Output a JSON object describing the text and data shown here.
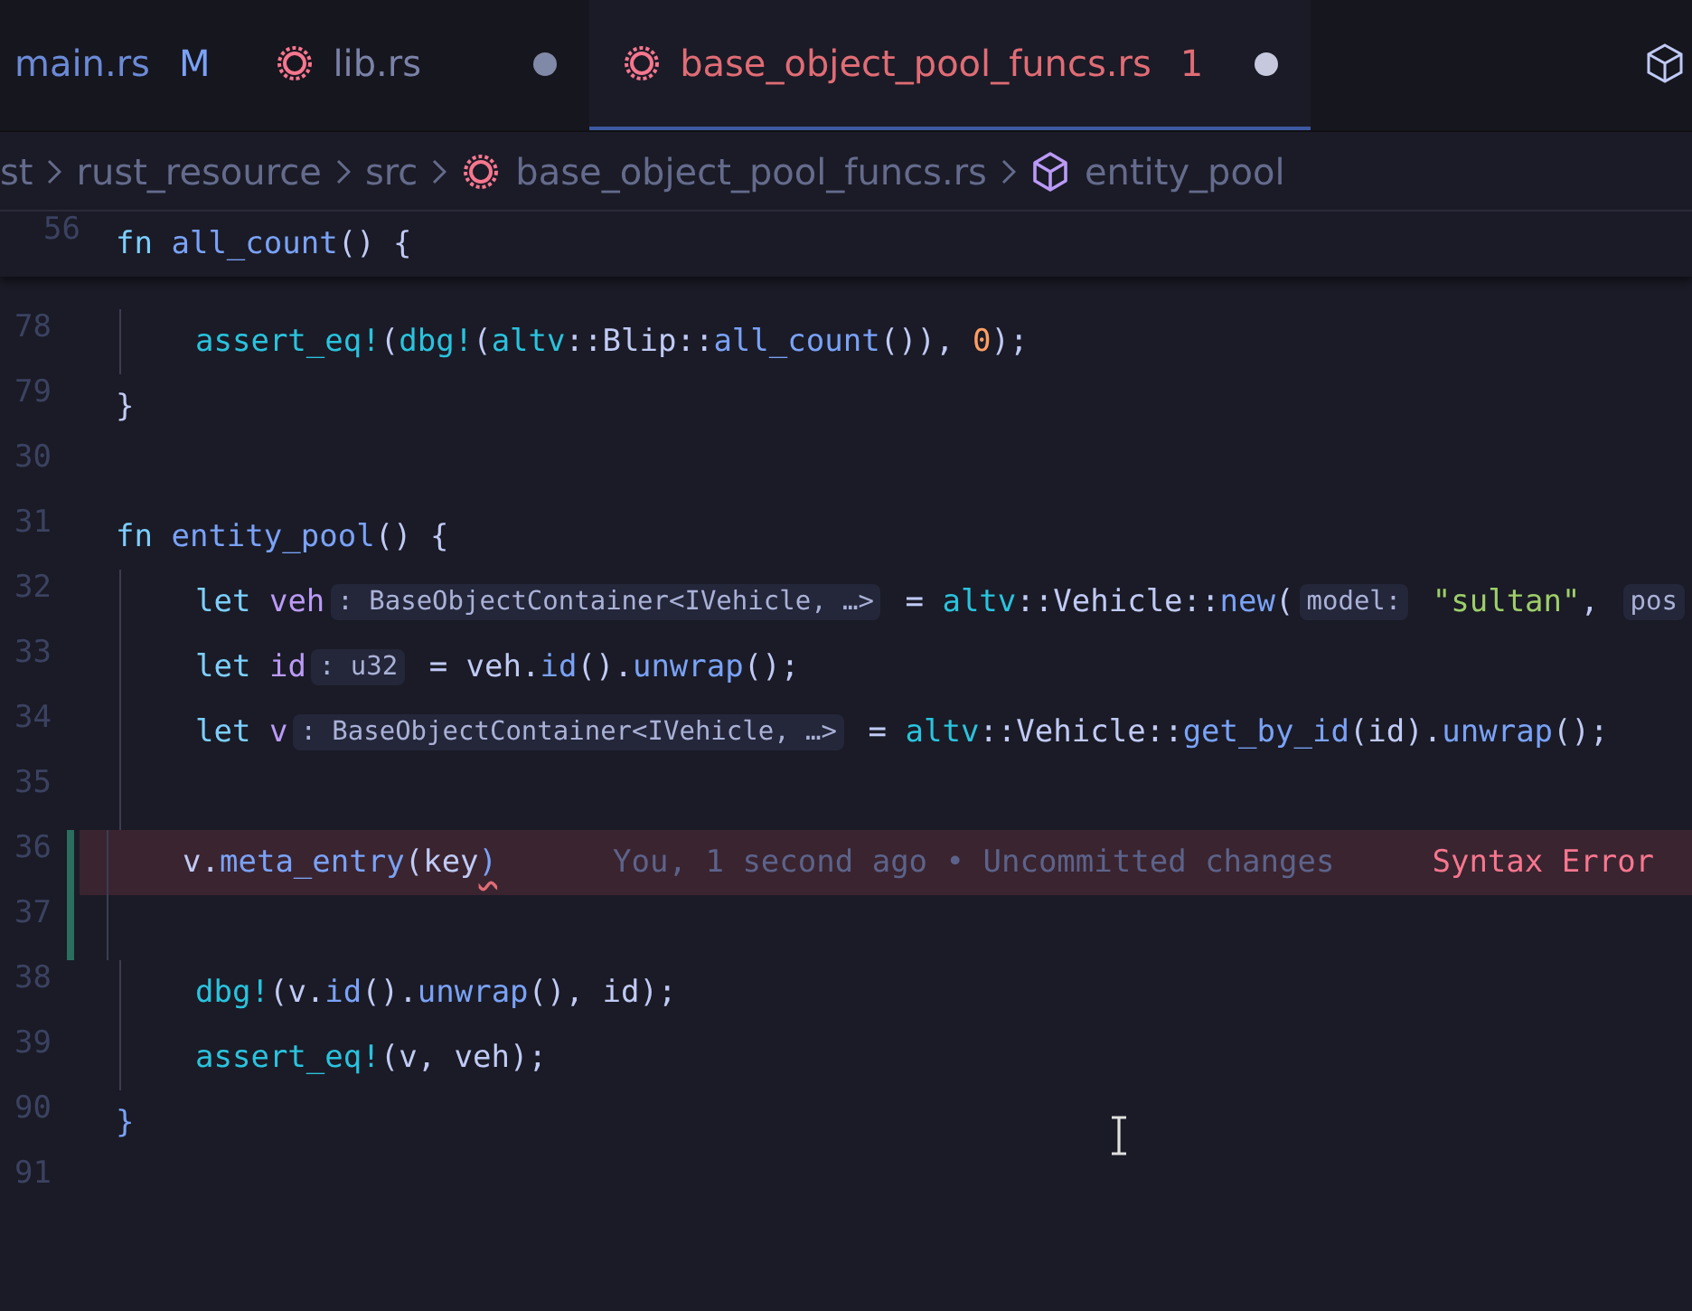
{
  "tabs": [
    {
      "label": "main.rs",
      "kind": "plain",
      "status": "M",
      "dirty": false,
      "error": false,
      "selected": false
    },
    {
      "label": "lib.rs",
      "kind": "rust",
      "dirty": true,
      "error": false,
      "selected": false
    },
    {
      "label": "base_object_pool_funcs.rs",
      "kind": "rust",
      "status": "1",
      "dirty": true,
      "error": true,
      "selected": true
    }
  ],
  "breadcrumb": [
    {
      "label": "st",
      "kind": "folder"
    },
    {
      "label": "rust_resource",
      "kind": "folder"
    },
    {
      "label": "src",
      "kind": "folder"
    },
    {
      "label": "base_object_pool_funcs.rs",
      "kind": "rust"
    },
    {
      "label": "entity_pool",
      "kind": "struct"
    }
  ],
  "sticky_line": {
    "number": "56",
    "tokens": [
      {
        "kind": "keyword",
        "text": "fn "
      },
      {
        "kind": "function",
        "text": "all_count"
      },
      {
        "kind": "punct",
        "text": "() {"
      }
    ]
  },
  "lines": [
    {
      "number": "78",
      "indented": true,
      "modified": false,
      "error": false,
      "tokens": [
        {
          "kind": "macro",
          "text": "assert_eq!"
        },
        {
          "kind": "punct",
          "text": "("
        },
        {
          "kind": "macro",
          "text": "dbg!"
        },
        {
          "kind": "punct",
          "text": "("
        },
        {
          "kind": "namespace",
          "text": "altv"
        },
        {
          "kind": "punct",
          "text": "::"
        },
        {
          "kind": "type",
          "text": "Blip"
        },
        {
          "kind": "punct",
          "text": "::"
        },
        {
          "kind": "function",
          "text": "all_count"
        },
        {
          "kind": "punct",
          "text": "()), "
        },
        {
          "kind": "number",
          "text": "0"
        },
        {
          "kind": "punct",
          "text": ");"
        }
      ]
    },
    {
      "number": "79",
      "indented": false,
      "modified": false,
      "error": false,
      "tokens": [
        {
          "kind": "punct",
          "text": "}"
        }
      ]
    },
    {
      "number": "30",
      "indented": false,
      "modified": false,
      "error": false
    },
    {
      "number": "31",
      "indented": false,
      "modified": false,
      "error": false,
      "tokens": [
        {
          "kind": "keyword",
          "text": "fn "
        },
        {
          "kind": "function",
          "text": "entity_pool"
        },
        {
          "kind": "punct",
          "text": "() {"
        }
      ]
    },
    {
      "number": "32",
      "indented": true,
      "modified": false,
      "error": false,
      "tokens": [
        {
          "kind": "keyword",
          "text": "let "
        },
        {
          "kind": "variable",
          "text": "veh"
        },
        {
          "kind": "hint",
          "text": ": BaseObjectContainer<IVehicle, …>"
        },
        {
          "kind": "punct",
          "text": " = "
        },
        {
          "kind": "namespace",
          "text": "altv"
        },
        {
          "kind": "punct",
          "text": "::"
        },
        {
          "kind": "type",
          "text": "Vehicle"
        },
        {
          "kind": "punct",
          "text": "::"
        },
        {
          "kind": "function",
          "text": "new"
        },
        {
          "kind": "punct",
          "text": "("
        },
        {
          "kind": "hint",
          "text": "model:"
        },
        {
          "kind": "string",
          "text": " \"sultan\""
        },
        {
          "kind": "punct",
          "text": ", "
        },
        {
          "kind": "hint",
          "text": "pos"
        }
      ]
    },
    {
      "number": "33",
      "indented": true,
      "modified": false,
      "error": false,
      "tokens": [
        {
          "kind": "keyword",
          "text": "let "
        },
        {
          "kind": "variable",
          "text": "id"
        },
        {
          "kind": "hint",
          "text": ": u32"
        },
        {
          "kind": "punct",
          "text": " = veh."
        },
        {
          "kind": "function",
          "text": "id"
        },
        {
          "kind": "punct",
          "text": "()."
        },
        {
          "kind": "function",
          "text": "unwrap"
        },
        {
          "kind": "punct",
          "text": "();"
        }
      ]
    },
    {
      "number": "34",
      "indented": true,
      "modified": false,
      "error": false,
      "tokens": [
        {
          "kind": "keyword",
          "text": "let "
        },
        {
          "kind": "variable",
          "text": "v"
        },
        {
          "kind": "hint",
          "text": ": BaseObjectContainer<IVehicle, …>"
        },
        {
          "kind": "punct",
          "text": " = "
        },
        {
          "kind": "namespace",
          "text": "altv"
        },
        {
          "kind": "punct",
          "text": "::"
        },
        {
          "kind": "type",
          "text": "Vehicle"
        },
        {
          "kind": "punct",
          "text": "::"
        },
        {
          "kind": "function",
          "text": "get_by_id"
        },
        {
          "kind": "punct",
          "text": "(id)."
        },
        {
          "kind": "function",
          "text": "unwrap"
        },
        {
          "kind": "punct",
          "text": "();"
        }
      ]
    },
    {
      "number": "35",
      "indented": true,
      "modified": false,
      "error": false
    },
    {
      "number": "36",
      "indented": true,
      "modified": true,
      "error": true,
      "blame": "You, 1 second ago • Uncommitted changes",
      "message": "Syntax Error",
      "tokens": [
        {
          "kind": "punct",
          "text": "v."
        },
        {
          "kind": "function",
          "text": "meta_entry"
        },
        {
          "kind": "punct",
          "text": "(key"
        },
        {
          "kind": "squiggle",
          "text": ")"
        }
      ]
    },
    {
      "number": "37",
      "indented": true,
      "modified": true,
      "error": false
    },
    {
      "number": "38",
      "indented": true,
      "modified": false,
      "error": false,
      "tokens": [
        {
          "kind": "macro",
          "text": "dbg!"
        },
        {
          "kind": "punct",
          "text": "(v."
        },
        {
          "kind": "function",
          "text": "id"
        },
        {
          "kind": "punct",
          "text": "()."
        },
        {
          "kind": "function",
          "text": "unwrap"
        },
        {
          "kind": "punct",
          "text": "(), id);"
        }
      ]
    },
    {
      "number": "39",
      "indented": true,
      "modified": false,
      "error": false,
      "tokens": [
        {
          "kind": "macro",
          "text": "assert_eq!"
        },
        {
          "kind": "punct",
          "text": "(v, veh);"
        }
      ]
    },
    {
      "number": "90",
      "indented": false,
      "modified": false,
      "error": false,
      "tokens": [
        {
          "kind": "function",
          "text": "}"
        }
      ]
    },
    {
      "number": "91",
      "indented": false,
      "modified": false,
      "error": false
    }
  ]
}
